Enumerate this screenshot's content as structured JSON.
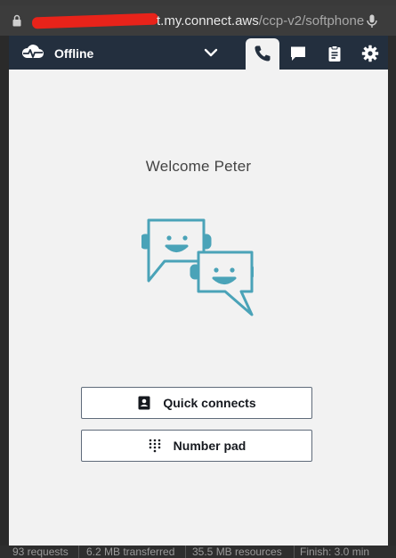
{
  "browser": {
    "url_host": "t.my.connect.aws",
    "url_path": "/ccp-v2/softphone"
  },
  "topbar": {
    "status": "Offline",
    "tabs": [
      "phone-icon",
      "chat-icon",
      "clipboard-icon",
      "gear-icon"
    ]
  },
  "main": {
    "welcome": "Welcome Peter"
  },
  "buttons": {
    "quick_connects": "Quick connects",
    "number_pad": "Number pad"
  },
  "devtools_footer": {
    "requests": "93 requests",
    "transferred": "6.2 MB transferred",
    "resources": "35.5 MB resources",
    "finish": "Finish: 3.0 min"
  },
  "colors": {
    "topbar": "#232f3e",
    "accent": "#4aa3b8",
    "panel": "#f2f2f2"
  }
}
